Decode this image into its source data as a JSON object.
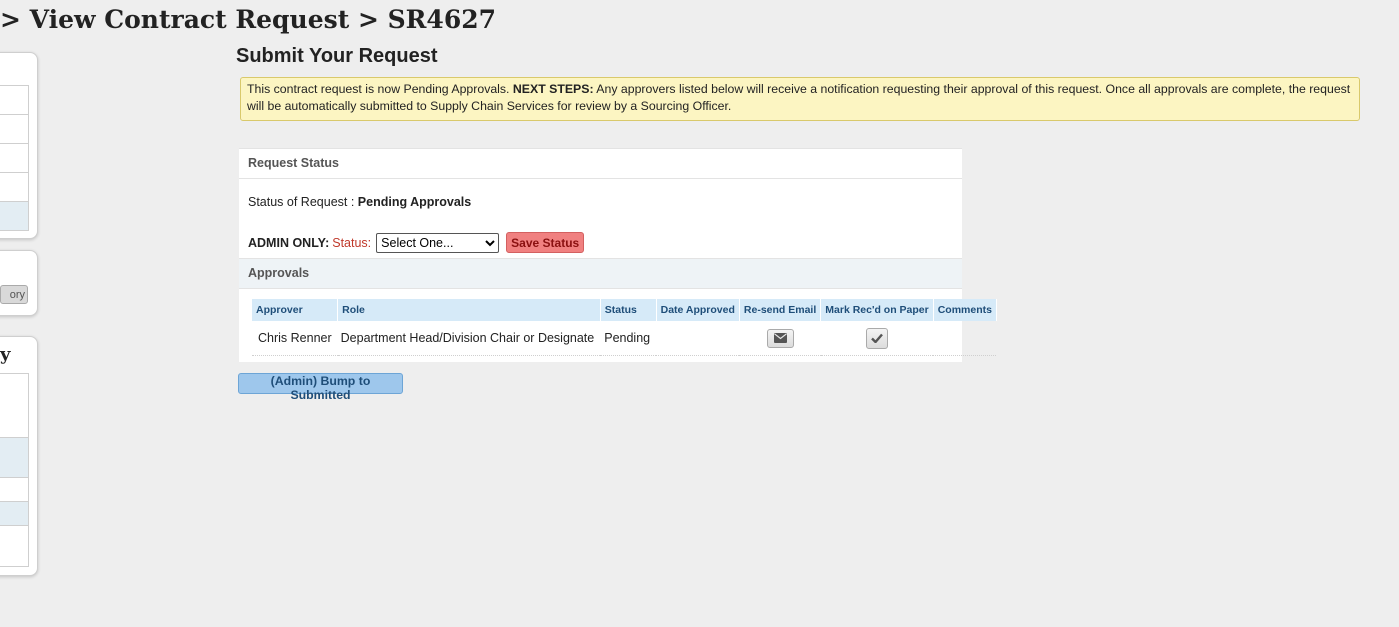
{
  "breadcrumb": "> View Contract Request > SR4627",
  "left_panels": {
    "panel2_button_label": "ory",
    "panel3_title": "y"
  },
  "submit": {
    "title": "Submit Your Request",
    "notice_prefix": "This contract request is now Pending Approvals.",
    "notice_bold": "NEXT STEPS:",
    "notice_rest": "Any approvers listed below will receive a notification requesting their approval of this request. Once all approvals are complete, the request will be automatically submitted to Supply Chain Services for review by a Sourcing Officer."
  },
  "request_status": {
    "header": "Request Status",
    "status_label": "Status of Request :",
    "status_value": "Pending Approvals",
    "admin_label": "ADMIN ONLY:",
    "status_field_label": "Status:",
    "select_value": "Select One...",
    "save_button": "Save Status"
  },
  "approvals": {
    "header": "Approvals",
    "columns": [
      "Approver",
      "Role",
      "Status",
      "Date Approved",
      "Re-send Email",
      "Mark Rec'd on Paper",
      "Comments"
    ],
    "rows": [
      {
        "approver": "Chris Renner",
        "role": "Department Head/Division Chair or Designate",
        "status": "Pending",
        "date_approved": "",
        "resend_icon": "envelope-icon",
        "mark_icon": "checkmark-icon",
        "comments": ""
      }
    ]
  },
  "bump_button": "(Admin) Bump to Submitted"
}
